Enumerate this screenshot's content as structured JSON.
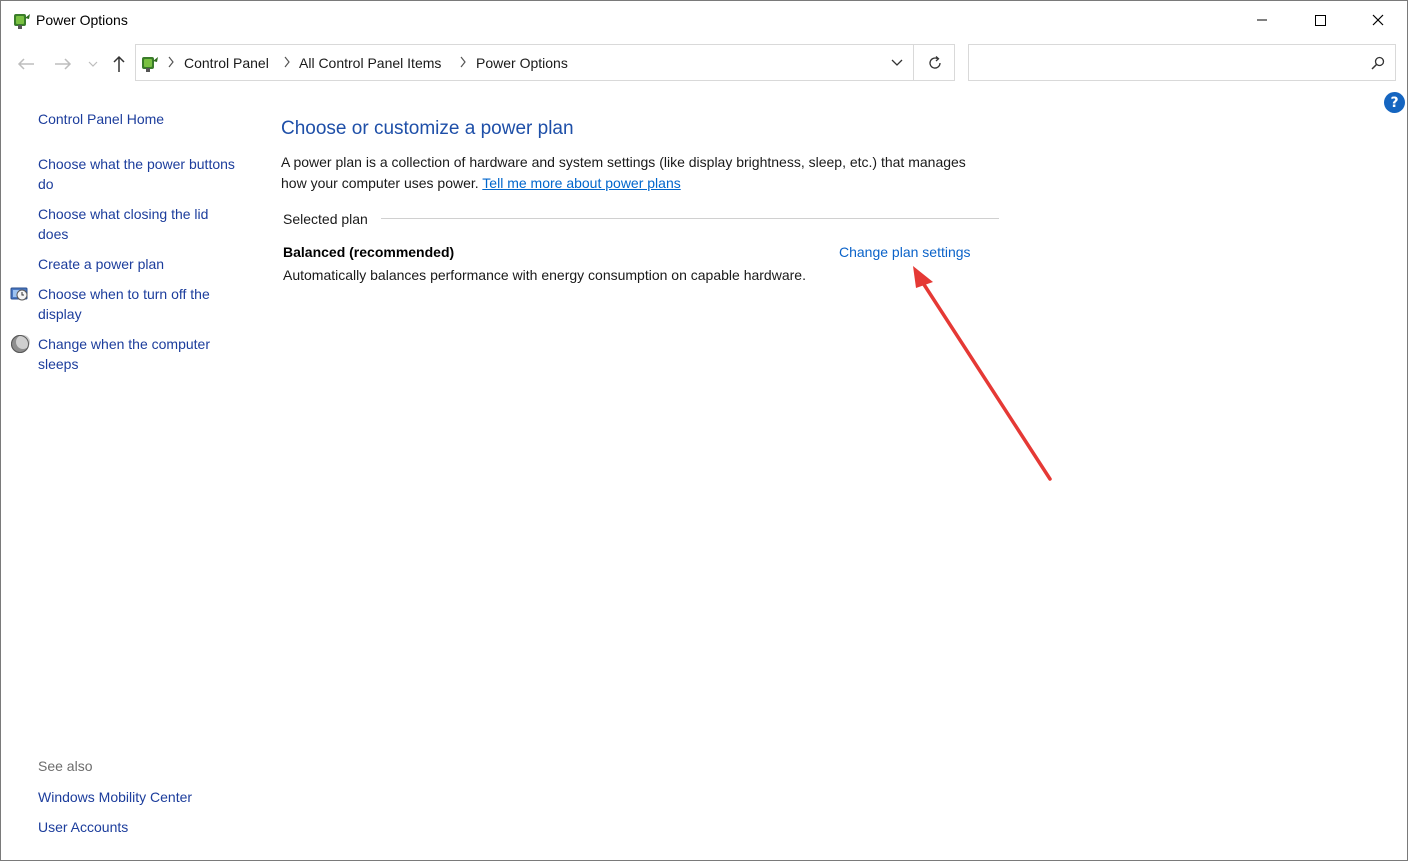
{
  "window": {
    "title": "Power Options",
    "controls": [
      "minimize",
      "maximize",
      "close"
    ]
  },
  "addressbar": {
    "crumbs": [
      "Control Panel",
      "All Control Panel Items",
      "Power Options"
    ]
  },
  "search": {
    "value": "",
    "placeholder": ""
  },
  "sidebar": {
    "items": [
      {
        "label": "Control Panel Home",
        "icon": null
      },
      {
        "label": "Choose what the power buttons do",
        "icon": null
      },
      {
        "label": "Choose what closing the lid does",
        "icon": null
      },
      {
        "label": "Create a power plan",
        "icon": null
      },
      {
        "label": "Choose when to turn off the display",
        "icon": "display-clock-icon"
      },
      {
        "label": "Change when the computer sleeps",
        "icon": "moon-icon"
      }
    ],
    "see_also_heading": "See also",
    "see_also": [
      {
        "label": "Windows Mobility Center"
      },
      {
        "label": "User Accounts"
      }
    ]
  },
  "main": {
    "title": "Choose or customize a power plan",
    "description": "A power plan is a collection of hardware and system settings (like display brightness, sleep, etc.) that manages how your computer uses power.",
    "learn_more_link": "Tell me more about power plans",
    "selected_plan_label": "Selected plan",
    "plan": {
      "name": "Balanced (recommended)",
      "description": "Automatically balances performance with energy consumption on capable hardware.",
      "change_link": "Change plan settings"
    }
  },
  "annotation": {
    "arrow_color": "#e53935"
  },
  "colors": {
    "link": "#1c3d9c",
    "title": "#1e4fa8",
    "help": "#1565c0"
  }
}
